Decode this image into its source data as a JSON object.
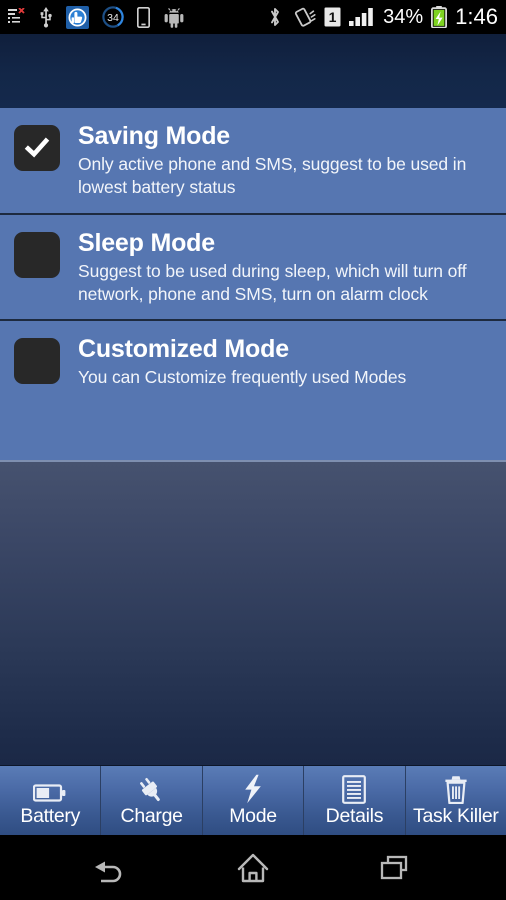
{
  "statusbar": {
    "left_icons": [
      {
        "name": "list-error-icon",
        "label": "list-error"
      },
      {
        "name": "usb-icon",
        "label": "usb"
      },
      {
        "name": "clean-master-icon",
        "label": "clean-master"
      },
      {
        "name": "battery-percent-circle-icon",
        "label": "34"
      },
      {
        "name": "device-icon",
        "label": "device"
      },
      {
        "name": "android-robot-icon",
        "label": "android"
      }
    ],
    "right_icons": [
      {
        "name": "bluetooth-icon",
        "label": "bluetooth"
      },
      {
        "name": "vibrate-icon",
        "label": "vibrate"
      },
      {
        "name": "sim-1-icon",
        "label": "1"
      },
      {
        "name": "signal-bars-icon",
        "label": "signal"
      }
    ],
    "battery_percent": "34%",
    "battery_charging_icon": "battery-charging-icon",
    "clock": "1:46",
    "circle_badge_value": "34"
  },
  "modes": [
    {
      "title": "Saving Mode",
      "description": "Only active phone and SMS, suggest to be used in lowest battery status",
      "checked": true
    },
    {
      "title": "Sleep Mode",
      "description": "Suggest to be used during sleep, which will turn off network, phone and SMS, turn on alarm clock",
      "checked": false
    },
    {
      "title": "Customized Mode",
      "description": "You can Customize frequently used Modes",
      "checked": false
    }
  ],
  "tabs": [
    {
      "label": "Battery",
      "icon": "battery-icon",
      "active": false
    },
    {
      "label": "Charge",
      "icon": "plug-icon",
      "active": false
    },
    {
      "label": "Mode",
      "icon": "bolt-icon",
      "active": true
    },
    {
      "label": "Details",
      "icon": "document-icon",
      "active": false
    },
    {
      "label": "Task Killer",
      "icon": "trash-icon",
      "active": false
    }
  ],
  "navbar": [
    {
      "name": "back-icon",
      "label": "Back"
    },
    {
      "name": "home-icon",
      "label": "Home"
    },
    {
      "name": "recents-icon",
      "label": "Recents"
    }
  ],
  "colors": {
    "list_blue": "#5676b1",
    "header_navy": "#132748",
    "checkbox_dark": "#282828",
    "tab_blue": "#4a6aa6",
    "tab_active_blue": "#36507c",
    "text_white": "#ffffff",
    "battery_green": "#7ed321"
  }
}
